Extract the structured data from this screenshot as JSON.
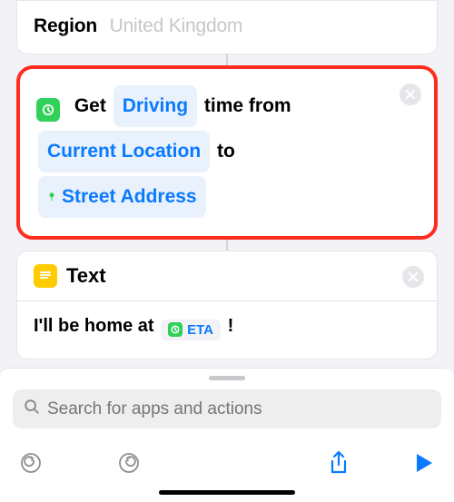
{
  "regionCard": {
    "label": "Region",
    "value": "United Kingdom"
  },
  "travelAction": {
    "parts": {
      "before_mode": "Get",
      "mode": "Driving",
      "after_mode": "time from",
      "origin": "Current Location",
      "conj": "to",
      "destination": "Street Address"
    }
  },
  "textCard": {
    "title": "Text",
    "body_before": "I'll be home at",
    "eta_label": "ETA",
    "body_after": "!"
  },
  "search": {
    "placeholder": "Search for apps and actions"
  },
  "colors": {
    "accent_blue": "#0a7aff",
    "accent_green": "#30d158",
    "accent_yellow": "#ffcc00",
    "highlight_red": "#ff2d1f"
  }
}
